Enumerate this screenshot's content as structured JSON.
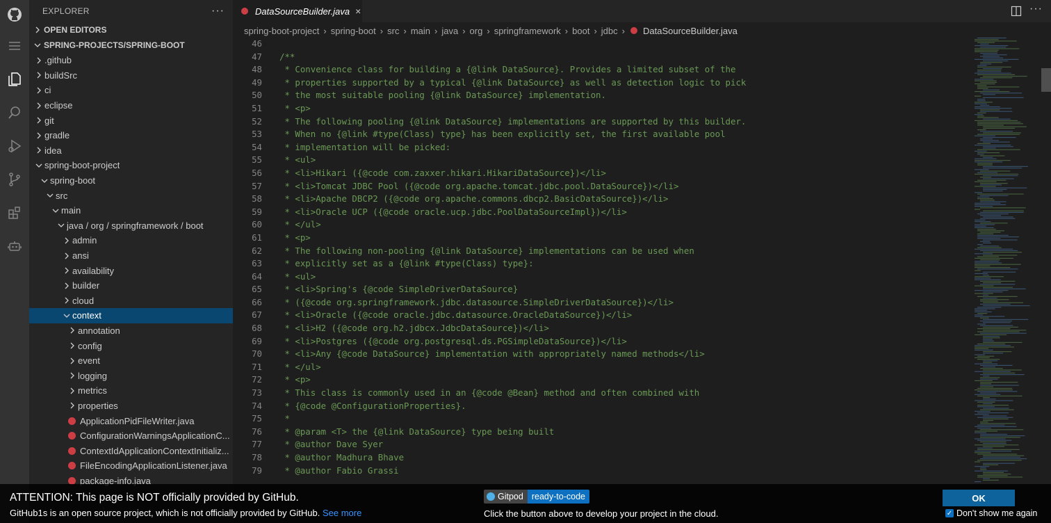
{
  "sidebar": {
    "title": "EXPLORER",
    "more": "···",
    "sections": {
      "open_editors": "OPEN EDITORS",
      "workspace": "SPRING-PROJECTS/SPRING-BOOT"
    },
    "tree": [
      {
        "label": ".github",
        "depth": 0,
        "type": "folder",
        "expanded": false
      },
      {
        "label": "buildSrc",
        "depth": 0,
        "type": "folder",
        "expanded": false
      },
      {
        "label": "ci",
        "depth": 0,
        "type": "folder",
        "expanded": false
      },
      {
        "label": "eclipse",
        "depth": 0,
        "type": "folder",
        "expanded": false
      },
      {
        "label": "git",
        "depth": 0,
        "type": "folder",
        "expanded": false
      },
      {
        "label": "gradle",
        "depth": 0,
        "type": "folder",
        "expanded": false
      },
      {
        "label": "idea",
        "depth": 0,
        "type": "folder",
        "expanded": false
      },
      {
        "label": "spring-boot-project",
        "depth": 0,
        "type": "folder",
        "expanded": true
      },
      {
        "label": "spring-boot",
        "depth": 1,
        "type": "folder",
        "expanded": true
      },
      {
        "label": "src",
        "depth": 2,
        "type": "folder",
        "expanded": true
      },
      {
        "label": "main",
        "depth": 3,
        "type": "folder",
        "expanded": true
      },
      {
        "label": "java / org / springframework / boot",
        "depth": 4,
        "type": "folder",
        "expanded": true
      },
      {
        "label": "admin",
        "depth": 5,
        "type": "folder",
        "expanded": false
      },
      {
        "label": "ansi",
        "depth": 5,
        "type": "folder",
        "expanded": false
      },
      {
        "label": "availability",
        "depth": 5,
        "type": "folder",
        "expanded": false
      },
      {
        "label": "builder",
        "depth": 5,
        "type": "folder",
        "expanded": false
      },
      {
        "label": "cloud",
        "depth": 5,
        "type": "folder",
        "expanded": false
      },
      {
        "label": "context",
        "depth": 5,
        "type": "folder",
        "expanded": true,
        "selected": true
      },
      {
        "label": "annotation",
        "depth": 6,
        "type": "folder",
        "expanded": false
      },
      {
        "label": "config",
        "depth": 6,
        "type": "folder",
        "expanded": false
      },
      {
        "label": "event",
        "depth": 6,
        "type": "folder",
        "expanded": false
      },
      {
        "label": "logging",
        "depth": 6,
        "type": "folder",
        "expanded": false
      },
      {
        "label": "metrics",
        "depth": 6,
        "type": "folder",
        "expanded": false
      },
      {
        "label": "properties",
        "depth": 6,
        "type": "folder",
        "expanded": false
      },
      {
        "label": "ApplicationPidFileWriter.java",
        "depth": 6,
        "type": "java"
      },
      {
        "label": "ConfigurationWarningsApplicationC...",
        "depth": 6,
        "type": "java"
      },
      {
        "label": "ContextIdApplicationContextInitializ...",
        "depth": 6,
        "type": "java"
      },
      {
        "label": "FileEncodingApplicationListener.java",
        "depth": 6,
        "type": "java"
      },
      {
        "label": "package-info.java",
        "depth": 6,
        "type": "java"
      }
    ]
  },
  "editor": {
    "tab_label": "DataSourceBuilder.java",
    "tab_close": "×",
    "more": "···",
    "breadcrumb": [
      "spring-boot-project",
      "spring-boot",
      "src",
      "main",
      "java",
      "org",
      "springframework",
      "boot",
      "jdbc",
      "DataSourceBuilder.java"
    ],
    "lines": [
      {
        "n": "46",
        "text": ""
      },
      {
        "n": "47",
        "text": "/**"
      },
      {
        "n": "48",
        "text": " * Convenience class for building a {@link DataSource}. Provides a limited subset of the"
      },
      {
        "n": "49",
        "text": " * properties supported by a typical {@link DataSource} as well as detection logic to pick"
      },
      {
        "n": "50",
        "text": " * the most suitable pooling {@link DataSource} implementation."
      },
      {
        "n": "51",
        "text": " * <p>"
      },
      {
        "n": "52",
        "text": " * The following pooling {@link DataSource} implementations are supported by this builder."
      },
      {
        "n": "53",
        "text": " * When no {@link #type(Class) type} has been explicitly set, the first available pool"
      },
      {
        "n": "54",
        "text": " * implementation will be picked:"
      },
      {
        "n": "55",
        "text": " * <ul>"
      },
      {
        "n": "56",
        "text": " * <li>Hikari ({@code com.zaxxer.hikari.HikariDataSource})</li>"
      },
      {
        "n": "57",
        "text": " * <li>Tomcat JDBC Pool ({@code org.apache.tomcat.jdbc.pool.DataSource})</li>"
      },
      {
        "n": "58",
        "text": " * <li>Apache DBCP2 ({@code org.apache.commons.dbcp2.BasicDataSource})</li>"
      },
      {
        "n": "59",
        "text": " * <li>Oracle UCP ({@code oracle.ucp.jdbc.PoolDataSourceImpl})</li>"
      },
      {
        "n": "60",
        "text": " * </ul>"
      },
      {
        "n": "61",
        "text": " * <p>"
      },
      {
        "n": "62",
        "text": " * The following non-pooling {@link DataSource} implementations can be used when"
      },
      {
        "n": "63",
        "text": " * explicitly set as a {@link #type(Class) type}:"
      },
      {
        "n": "64",
        "text": " * <ul>"
      },
      {
        "n": "65",
        "text": " * <li>Spring's {@code SimpleDriverDataSource}"
      },
      {
        "n": "66",
        "text": " * ({@code org.springframework.jdbc.datasource.SimpleDriverDataSource})</li>"
      },
      {
        "n": "67",
        "text": " * <li>Oracle ({@code oracle.jdbc.datasource.OracleDataSource})</li>"
      },
      {
        "n": "68",
        "text": " * <li>H2 ({@code org.h2.jdbcx.JdbcDataSource})</li>"
      },
      {
        "n": "69",
        "text": " * <li>Postgres ({@code org.postgresql.ds.PGSimpleDataSource})</li>"
      },
      {
        "n": "70",
        "text": " * <li>Any {@code DataSource} implementation with appropriately named methods</li>"
      },
      {
        "n": "71",
        "text": " * </ul>"
      },
      {
        "n": "72",
        "text": " * <p>"
      },
      {
        "n": "73",
        "text": " * This class is commonly used in an {@code @Bean} method and often combined with"
      },
      {
        "n": "74",
        "text": " * {@code @ConfigurationProperties}."
      },
      {
        "n": "75",
        "text": " *"
      },
      {
        "n": "76",
        "text": " * @param <T> the {@link DataSource} type being built"
      },
      {
        "n": "77",
        "text": " * @author Dave Syer"
      },
      {
        "n": "78",
        "text": " * @author Madhura Bhave"
      },
      {
        "n": "79",
        "text": " * @author Fabio Grassi"
      }
    ]
  },
  "banner": {
    "title": "ATTENTION: This page is NOT officially provided by GitHub.",
    "subtitle": "GitHub1s is an open source project, which is not officially provided by GitHub.",
    "link": "See more",
    "gitpod_name": "Gitpod",
    "gitpod_status": "ready-to-code",
    "gitpod_text": "Click the button above to develop your project in the cloud.",
    "ok_label": "OK",
    "dont_show": "Don't show me again"
  },
  "colors": {
    "accent": "#0e70c0",
    "selection": "#094771",
    "comment": "#6a9955",
    "java_icon": "#cc3e44"
  }
}
